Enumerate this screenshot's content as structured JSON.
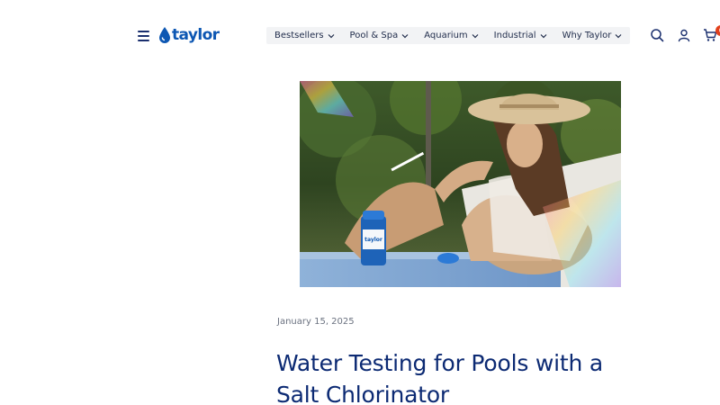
{
  "brand": {
    "logo_text": "taylor",
    "logo_color": "#0d57b3"
  },
  "nav": {
    "items": [
      {
        "label": "Bestsellers",
        "icon": "chevron-down-icon"
      },
      {
        "label": "Pool & Spa",
        "icon": "chevron-down-icon"
      },
      {
        "label": "Aquarium",
        "icon": "chevron-down-icon"
      },
      {
        "label": "Industrial",
        "icon": "chevron-down-icon"
      },
      {
        "label": "Why Taylor",
        "icon": "chevron-down-icon"
      }
    ]
  },
  "header_icons": {
    "menu": "hamburger-menu-icon",
    "search": "search-icon",
    "account": "user-icon",
    "cart": "cart-icon",
    "cart_count": "0"
  },
  "hero": {
    "image": "woman-in-sun-hat-holding-test-strip-beside-taylor-bottle-poolside-photo"
  },
  "post": {
    "date": "January 15, 2025",
    "title": "Water Testing for Pools with a Salt Chlorinator"
  },
  "colors": {
    "title": "#0c2a73",
    "date": "#6b7280",
    "nav_bg": "#f2f3f5",
    "badge": "#e2401c"
  }
}
